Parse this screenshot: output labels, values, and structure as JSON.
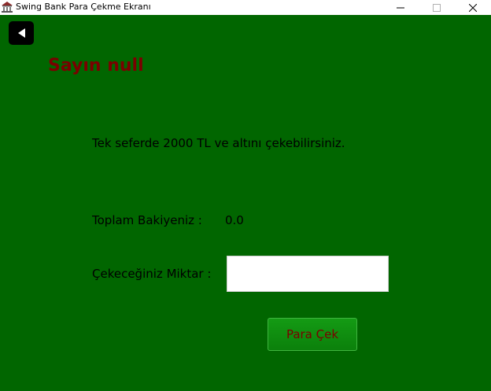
{
  "window": {
    "title": "Swing Bank Para Çekme Ekranı",
    "icon": "bank-app-icon"
  },
  "controls": {
    "minimize_icon": "minimize-icon",
    "maximize_icon": "maximize-icon",
    "close_icon": "close-icon"
  },
  "colors": {
    "background": "#016600",
    "accent_text": "#7a0000",
    "button": "#0b800b"
  },
  "header": {
    "back_icon": "triangle-left-icon",
    "greeting": "Sayın null"
  },
  "main": {
    "info": "Tek seferde 2000 TL ve altını çekebilirsiniz.",
    "balance_label": "Toplam Bakiyeniz  :",
    "balance_value": "0.0",
    "amount_label": "Çekeceğiniz Miktar :",
    "amount_value": "",
    "withdraw_label": "Para Çek"
  }
}
